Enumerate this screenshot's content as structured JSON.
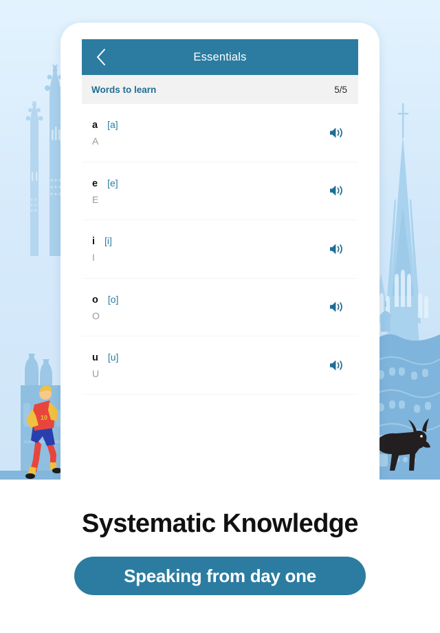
{
  "theme": {
    "accent": "#2b7ca0",
    "accent_text": "#1f6d94",
    "page_background": "#e3f3fe",
    "section_background": "#f2f2f2",
    "translation_text": "#9a9a9a"
  },
  "app": {
    "header": {
      "back_icon": "chevron-left-icon",
      "title": "Essentials"
    },
    "section": {
      "title": "Words to learn",
      "count": "5/5"
    },
    "words": [
      {
        "term": "a",
        "ipa": "[a]",
        "translation": "A",
        "audio_icon": "speaker-icon"
      },
      {
        "term": "e",
        "ipa": "[e]",
        "translation": "E",
        "audio_icon": "speaker-icon"
      },
      {
        "term": "i",
        "ipa": "[i]",
        "translation": "I",
        "audio_icon": "speaker-icon"
      },
      {
        "term": "o",
        "ipa": "[o]",
        "translation": "O",
        "audio_icon": "speaker-icon"
      },
      {
        "term": "u",
        "ipa": "[u]",
        "translation": "U",
        "audio_icon": "speaker-icon"
      }
    ]
  },
  "promo": {
    "headline": "Systematic Knowledge",
    "cta_label": "Speaking from day one"
  },
  "scenery": {
    "left": {
      "name": "sagrada-familia-spires-with-soccer-player",
      "figure": "soccer-player-illustration",
      "jersey_number": "10"
    },
    "right": {
      "name": "cathedral-spire-casa-mila-with-bull",
      "figure": "bull-illustration"
    }
  }
}
